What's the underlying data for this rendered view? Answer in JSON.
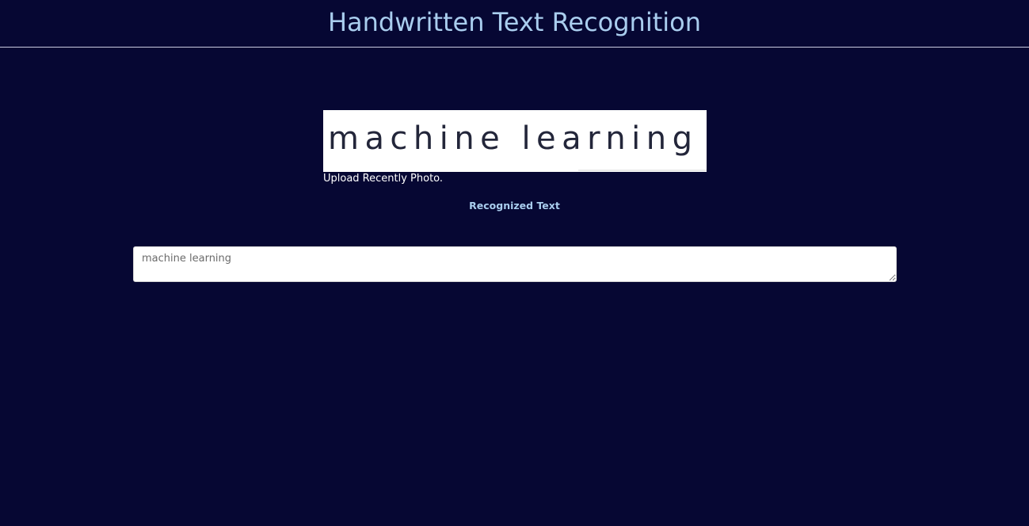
{
  "header": {
    "title": "Handwritten Text Recognition",
    "title_color": "#a9cdee"
  },
  "page": {
    "background_color": "#060733"
  },
  "upload": {
    "photo_text": "machine learning",
    "caption": "Upload Recently Photo."
  },
  "result": {
    "label": "Recognized Text",
    "text": "machine learning"
  }
}
